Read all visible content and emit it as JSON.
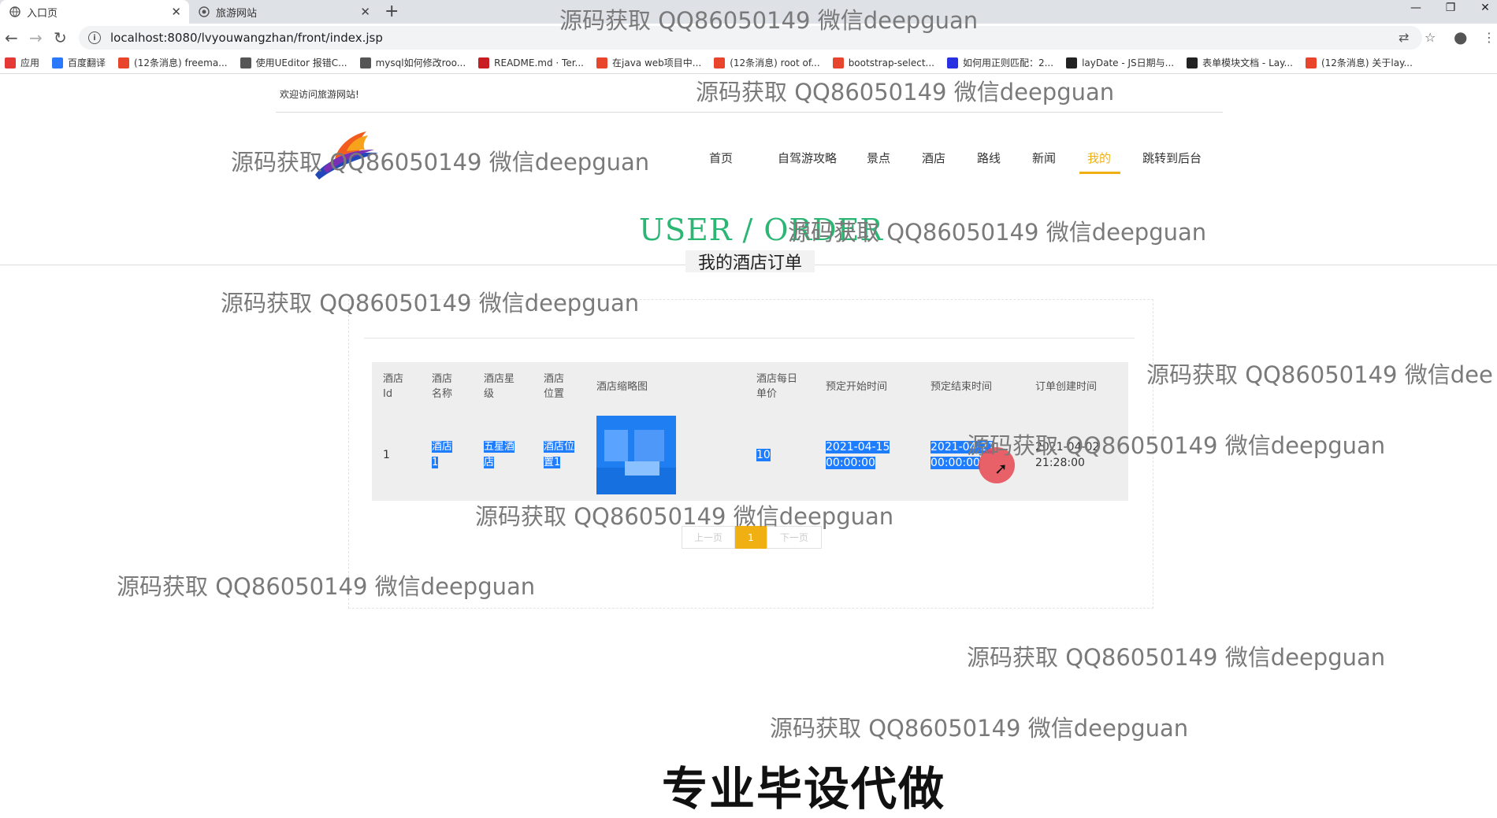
{
  "browser": {
    "tabs": [
      {
        "title": "入口页",
        "active": true
      },
      {
        "title": "旅游网站",
        "active": false
      }
    ],
    "url": "localhost:8080/lvyouwangzhan/front/index.jsp",
    "bookmarks": [
      {
        "label": "应用",
        "icon": "apps-grid-icon",
        "color": "#e53935"
      },
      {
        "label": "百度翻译",
        "icon": "baidu-translate-icon",
        "color": "#2979ff"
      },
      {
        "label": "(12条消息) freema...",
        "icon": "csdn-icon",
        "color": "#e8452c"
      },
      {
        "label": "使用UEditor 报错C...",
        "icon": "page-icon",
        "color": "#555555"
      },
      {
        "label": "mysql如何修改roo...",
        "icon": "page-icon",
        "color": "#555555"
      },
      {
        "label": "README.md · Ter...",
        "icon": "gitee-icon",
        "color": "#c71d23"
      },
      {
        "label": "在java web项目中...",
        "icon": "csdn-icon",
        "color": "#e8452c"
      },
      {
        "label": "(12条消息) root of...",
        "icon": "csdn-icon",
        "color": "#e8452c"
      },
      {
        "label": "bootstrap-select...",
        "icon": "page-icon",
        "color": "#e8452c"
      },
      {
        "label": "如何用正则匹配：2...",
        "icon": "baidu-icon",
        "color": "#2932e1"
      },
      {
        "label": "layDate - JS日期与...",
        "icon": "layui-icon",
        "color": "#222222"
      },
      {
        "label": "表单模块文档 - Lay...",
        "icon": "layui-icon",
        "color": "#222222"
      },
      {
        "label": "(12条消息) 关于lay...",
        "icon": "csdn-icon",
        "color": "#e8452c"
      }
    ]
  },
  "header": {
    "welcome": "欢迎访问旅游网站!",
    "nav": [
      {
        "label": "首页",
        "active": false
      },
      {
        "label": "自驾游攻略",
        "active": false
      },
      {
        "label": "景点",
        "active": false
      },
      {
        "label": "酒店",
        "active": false
      },
      {
        "label": "路线",
        "active": false
      },
      {
        "label": "新闻",
        "active": false
      },
      {
        "label": "我的",
        "active": true
      },
      {
        "label": "跳转到后台",
        "active": false
      }
    ],
    "accent_color": "#f0b012"
  },
  "section": {
    "title": "USER / ORDER",
    "subtitle": "我的酒店订单",
    "title_color": "#2bb673"
  },
  "table": {
    "columns": [
      "酒店Id",
      "酒店名称",
      "酒店星级",
      "酒店位置",
      "酒店缩略图",
      "酒店每日单价",
      "预定开始时间",
      "预定结束时间",
      "订单创建时间"
    ],
    "rows": [
      {
        "hotel_id": "1",
        "name": "酒店1",
        "star": "五星酒店",
        "location": "酒店位置1",
        "thumbnail": "hotel-room-thumbnail",
        "price": "10",
        "start": "2021-04-15 00:00:00",
        "end": "2021-04-21 00:00:00",
        "created": "2021-04-02 21:28:00"
      }
    ],
    "selection_color": "#1e7cff"
  },
  "pagination": {
    "prev": "上一页",
    "current": "1",
    "next": "下一页"
  },
  "watermark": {
    "text": "源码获取 QQ86050149 微信deepguan",
    "text_cut": "源码获取 QQ86050149 微信dee",
    "promo": "专业毕设代做"
  }
}
